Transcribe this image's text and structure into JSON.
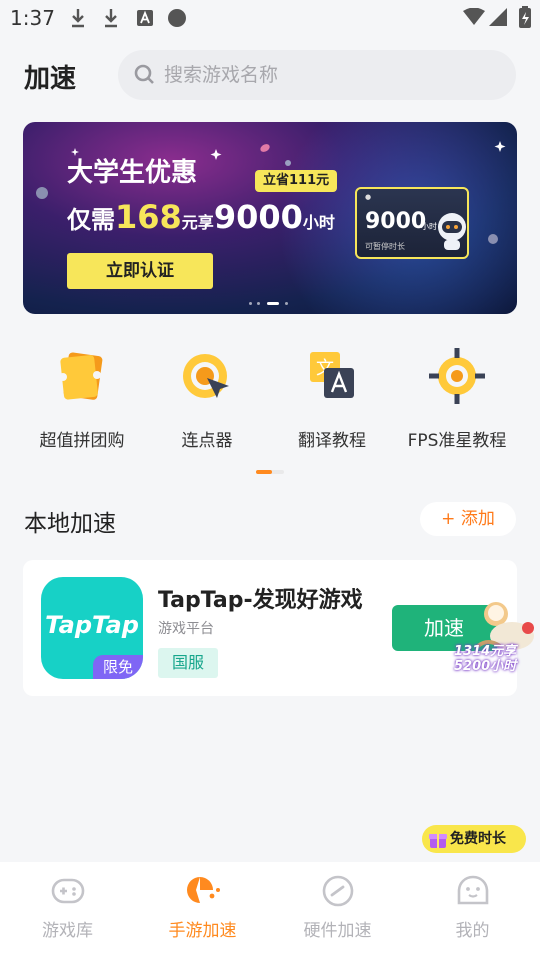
{
  "status_bar": {
    "time": "1:37"
  },
  "header": {
    "title": "加速",
    "search_placeholder": "搜索游戏名称"
  },
  "banner": {
    "title": "大学生优惠",
    "save_badge": "立省111元",
    "line_prefix": "仅需",
    "price": "168",
    "price_unit": "元享",
    "hours": "9000",
    "hours_unit": "小时",
    "cta_label": "立即认证",
    "card_hours": "9000",
    "card_unit": "小时",
    "card_note": "可暂停时长"
  },
  "quick_actions": [
    {
      "label": "超值拼团购",
      "icon": "ticket-icon"
    },
    {
      "label": "连点器",
      "icon": "auto-clicker-icon"
    },
    {
      "label": "翻译教程",
      "icon": "translate-icon"
    },
    {
      "label": "FPS准星教程",
      "icon": "crosshair-icon"
    }
  ],
  "local": {
    "section_title": "本地加速",
    "add_label": "+ 添加",
    "game": {
      "icon_text": "TapTap",
      "icon_tag": "限免",
      "name": "TapTap-发现好游戏",
      "category": "游戏平台",
      "region": "国服",
      "accel_label": "加速"
    },
    "promo_sticker": {
      "line1": "1314元享",
      "line2": "5200小时"
    }
  },
  "free_badge": {
    "label": "免费时长"
  },
  "bottom_nav": [
    {
      "label": "游戏库",
      "icon": "gamepad-icon",
      "active": false
    },
    {
      "label": "手游加速",
      "icon": "mobile-accel-icon",
      "active": true
    },
    {
      "label": "硬件加速",
      "icon": "speedometer-icon",
      "active": false
    },
    {
      "label": "我的",
      "icon": "profile-icon",
      "active": false
    }
  ],
  "colors": {
    "accent": "#ff8a1f",
    "green": "#1fb37a",
    "yellow": "#f7e65a",
    "teal": "#17d1c6"
  }
}
